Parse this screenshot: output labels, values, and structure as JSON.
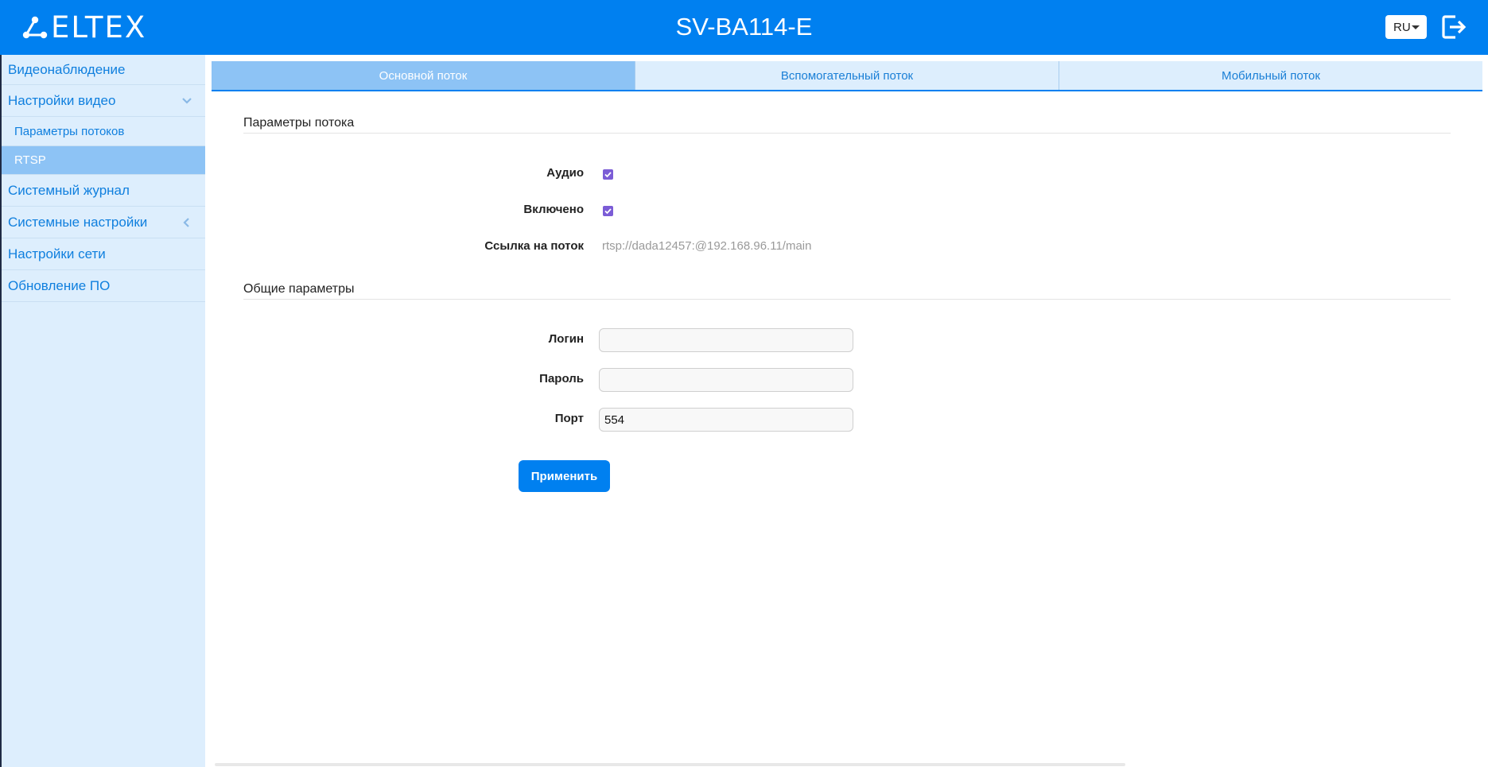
{
  "header": {
    "logo_text": "ELTEX",
    "title": "SV-BA114-E",
    "language": "RU"
  },
  "sidebar": {
    "items": [
      {
        "label": "Видеонаблюдение"
      },
      {
        "label": "Настройки видео"
      },
      {
        "label": "Параметры потоков"
      },
      {
        "label": "RTSP"
      },
      {
        "label": "Системный журнал"
      },
      {
        "label": "Системные настройки"
      },
      {
        "label": "Настройки сети"
      },
      {
        "label": "Обновление ПО"
      }
    ]
  },
  "tabs": [
    {
      "label": "Основной поток",
      "active": true
    },
    {
      "label": "Вспомогательный поток",
      "active": false
    },
    {
      "label": "Мобильный поток",
      "active": false
    }
  ],
  "stream_params": {
    "title": "Параметры потока",
    "audio_label": "Аудио",
    "audio_checked": true,
    "enabled_label": "Включено",
    "enabled_checked": true,
    "link_label": "Ссылка на поток",
    "link_value": "rtsp://dada12457:@192.168.96.11/main"
  },
  "general_params": {
    "title": "Общие параметры",
    "login_label": "Логин",
    "login_value": "",
    "password_label": "Пароль",
    "password_value": "",
    "port_label": "Порт",
    "port_value": "554"
  },
  "actions": {
    "apply_label": "Применить"
  },
  "colors": {
    "header_bg": "#0080f0",
    "sidebar_bg": "#ddeefd",
    "active_bg": "#8dc3f5",
    "checkbox": "#7b5cd6"
  }
}
